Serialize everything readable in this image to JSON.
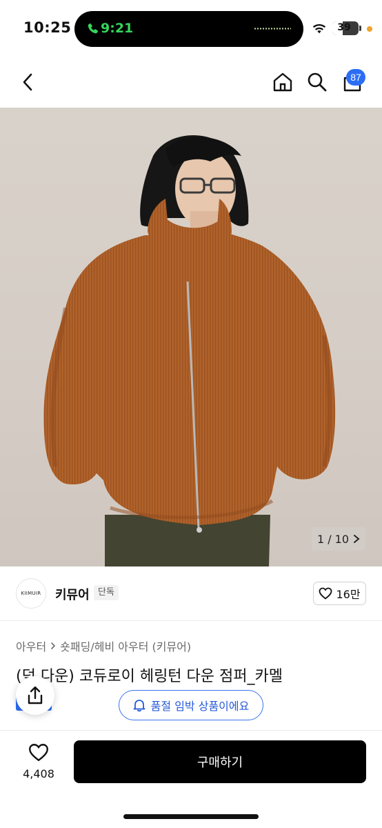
{
  "status_bar": {
    "time": "10:25",
    "call_time": "9:21",
    "battery": "39",
    "battery_level": 0.39,
    "icons": [
      "phone-icon",
      "wifi-icon",
      "battery-icon"
    ]
  },
  "nav": {
    "cart_count": "87",
    "icons": [
      "back-arrow-icon",
      "home-icon",
      "search-icon",
      "cart-icon"
    ]
  },
  "gallery": {
    "current": "1",
    "total": "10",
    "counter_text": "1 / 10"
  },
  "brand": {
    "logo_text": "KIIMUIR",
    "name": "키뮤어",
    "tag": "단독",
    "likes": "16만"
  },
  "product": {
    "breadcrumb": [
      "아우터",
      "숏패딩/헤비 아우터 (키뮤어)"
    ],
    "title": "(덕 다운) 코듀로이 헤링턴 다운 점퍼_카멜",
    "soldout_notice": "품절 임박 상품이에요"
  },
  "bottom": {
    "wish_count": "4,408",
    "buy_label": "구매하기"
  },
  "colors": {
    "accent_blue": "#2b6ef5",
    "call_green": "#36d55a",
    "buy_button": "#000000",
    "jacket": "#b0622a"
  }
}
